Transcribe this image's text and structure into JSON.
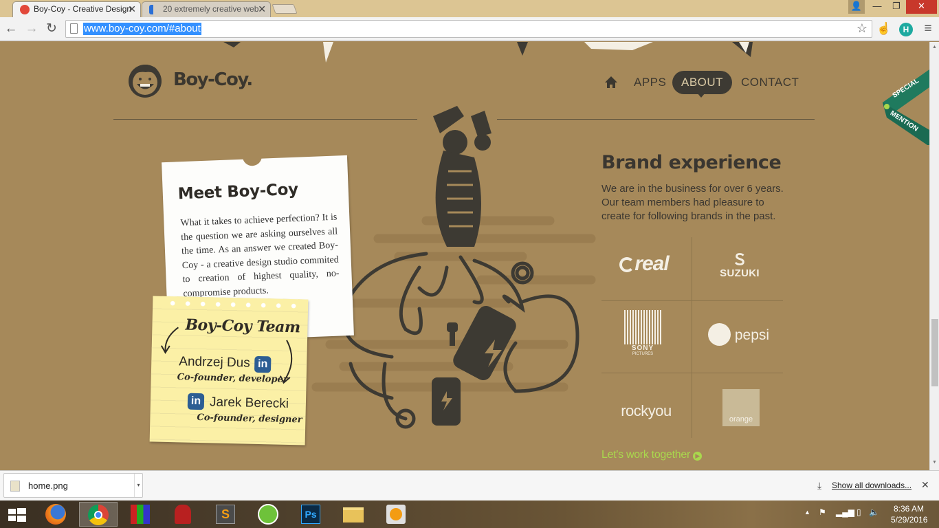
{
  "browser": {
    "tabs": [
      {
        "title": "Boy-Coy - Creative Design",
        "active": true
      },
      {
        "title": "20 extremely creative web",
        "active": false
      }
    ],
    "url": "www.boy-coy.com/#about",
    "profile_initial": "H"
  },
  "site": {
    "logo_text": "Boy-Coy.",
    "nav": [
      {
        "label": "APPS"
      },
      {
        "label": "ABOUT",
        "active": true
      },
      {
        "label": "CONTACT"
      }
    ],
    "ribbon": {
      "line1": "SPECIAL",
      "line2": "MENTION"
    },
    "meet": {
      "title": "Meet Boy-Coy",
      "body": "What it takes to achieve perfection? It is the question we are asking ourselves all the time. As an answer we created Boy-Coy - a creative design studio commited to creation of highest quality, no-compromise products."
    },
    "team": {
      "title": "Boy-Coy Team",
      "members": [
        {
          "name": "Andrzej Dus",
          "role": "Co-founder, developer"
        },
        {
          "name": "Jarek Berecki",
          "role": "Co-founder, designer"
        }
      ],
      "linkedin_label": "in"
    },
    "brand": {
      "title": "Brand experience",
      "text": "We are in the business for over 6 years. Our team members had pleasure to create for following brands in the past.",
      "logos": [
        "real",
        "SUZUKI",
        "SONY",
        "PICTURES",
        "pepsi",
        "rockyou",
        "orange"
      ],
      "cta": "Let's work together"
    },
    "colors": {
      "background": "#a6895a",
      "dark": "#3d3a33",
      "accent_green": "#a9d84d",
      "ribbon": "#1f7a5e"
    }
  },
  "downloads": {
    "file": "home.png",
    "show_all": "Show all downloads..."
  },
  "taskbar": {
    "time": "8:36 AM",
    "date": "5/29/2016",
    "apps": [
      "windows-start",
      "firefox",
      "chrome",
      "winrar",
      "app-red",
      "sublime",
      "green-app",
      "photoshop",
      "file-explorer",
      "media-player"
    ]
  }
}
